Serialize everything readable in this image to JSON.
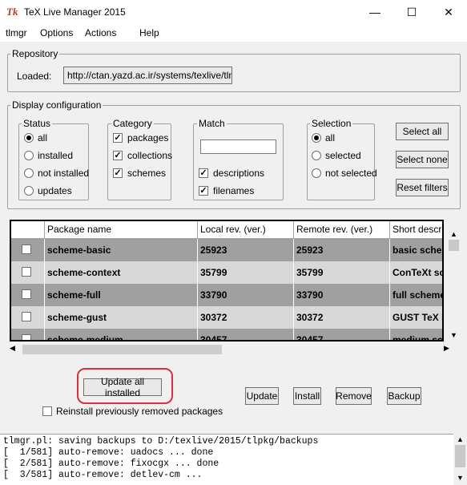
{
  "window": {
    "title": "TeX Live Manager 2015",
    "app_icon": "Tk",
    "minimize": "—",
    "maximize": "☐",
    "close": "✕"
  },
  "menu": [
    "tlmgr",
    "Options",
    "Actions",
    "Help"
  ],
  "repository": {
    "group_label": "Repository",
    "loaded_label": "Loaded:",
    "loaded_url": "http://ctan.yazd.ac.ir/systems/texlive/tlnet"
  },
  "display": {
    "group_label": "Display configuration",
    "status": {
      "label": "Status",
      "options": [
        "all",
        "installed",
        "not installed",
        "updates"
      ],
      "selected": "all"
    },
    "category": {
      "label": "Category",
      "options": [
        "packages",
        "collections",
        "schemes"
      ],
      "checked": [
        true,
        true,
        true
      ]
    },
    "match": {
      "label": "Match",
      "search_value": "",
      "options": [
        "descriptions",
        "filenames"
      ],
      "checked": [
        true,
        true
      ]
    },
    "selection": {
      "label": "Selection",
      "options": [
        "all",
        "selected",
        "not selected"
      ],
      "selected": "all"
    },
    "buttons": {
      "select_all": "Select all",
      "select_none": "Select none",
      "reset_filters": "Reset filters"
    }
  },
  "table": {
    "headers": [
      "",
      "Package name",
      "Local rev. (ver.)",
      "Remote rev. (ver.)",
      "Short descript"
    ],
    "rows": [
      {
        "checked": false,
        "name": "scheme-basic",
        "local": "25923",
        "remote": "25923",
        "desc": "basic schem"
      },
      {
        "checked": false,
        "name": "scheme-context",
        "local": "35799",
        "remote": "35799",
        "desc": "ConTeXt sc"
      },
      {
        "checked": false,
        "name": "scheme-full",
        "local": "33790",
        "remote": "33790",
        "desc": "full scheme"
      },
      {
        "checked": false,
        "name": "scheme-gust",
        "local": "30372",
        "remote": "30372",
        "desc": "GUST TeX L"
      },
      {
        "checked": false,
        "name": "scheme-medium",
        "local": "30457",
        "remote": "30457",
        "desc": "medium sch"
      }
    ],
    "row_colors": [
      "#a0a0a0",
      "#d8d8d8"
    ]
  },
  "actions": {
    "update_all": "Update all installed",
    "update": "Update",
    "install": "Install",
    "remove": "Remove",
    "backup": "Backup",
    "reinstall_label": "Reinstall previously removed packages",
    "reinstall_checked": false
  },
  "highlight_color": "#d9323a",
  "log_lines": [
    "tlmgr.pl: saving backups to D:/texlive/2015/tlpkg/backups",
    "[  1/581] auto-remove: uadocs ... done",
    "[  2/581] auto-remove: fixocgx ... done",
    "[  3/581] auto-remove: detlev-cm ..."
  ]
}
